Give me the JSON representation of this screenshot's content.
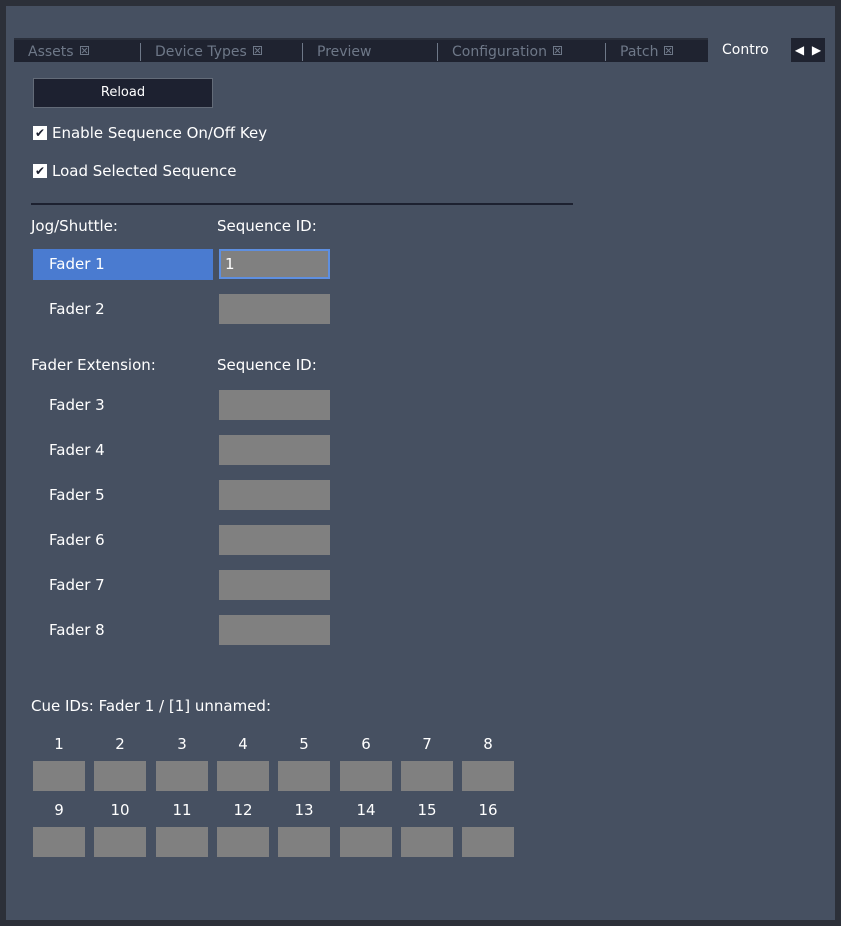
{
  "tabs": [
    {
      "label": "Assets",
      "closable": true,
      "active": false
    },
    {
      "label": "Device Types",
      "closable": true,
      "active": false
    },
    {
      "label": "Preview",
      "closable": false,
      "active": false
    },
    {
      "label": "Configuration",
      "closable": true,
      "active": false
    },
    {
      "label": "Patch",
      "closable": true,
      "active": false
    },
    {
      "label": "Contro",
      "closable": false,
      "active": true
    }
  ],
  "tab_scroll": {
    "left": "◀",
    "right": "▶"
  },
  "reload_label": "Reload",
  "options": {
    "enable_seq_key": {
      "label": "Enable Sequence On/Off Key",
      "checked": true
    },
    "load_selected": {
      "label": "Load Selected Sequence",
      "checked": true
    }
  },
  "jog": {
    "header_left": "Jog/Shuttle:",
    "header_right": "Sequence ID:",
    "rows": [
      {
        "label": "Fader 1",
        "value": "1"
      },
      {
        "label": "Fader 2",
        "value": ""
      }
    ]
  },
  "extension": {
    "header_left": "Fader Extension:",
    "header_right": "Sequence ID:",
    "rows": [
      {
        "label": "Fader 3",
        "value": ""
      },
      {
        "label": "Fader 4",
        "value": ""
      },
      {
        "label": "Fader 5",
        "value": ""
      },
      {
        "label": "Fader 6",
        "value": ""
      },
      {
        "label": "Fader 7",
        "value": ""
      },
      {
        "label": "Fader 8",
        "value": ""
      }
    ]
  },
  "cues": {
    "title": "Cue IDs: Fader 1 / [1] unnamed:",
    "row1": [
      "1",
      "2",
      "3",
      "4",
      "5",
      "6",
      "7",
      "8"
    ],
    "row2": [
      "9",
      "10",
      "11",
      "12",
      "13",
      "14",
      "15",
      "16"
    ]
  },
  "colors": {
    "panel": "#465061",
    "selected": "#4a7bd0",
    "input": "#808080",
    "dark": "#1d2130"
  }
}
